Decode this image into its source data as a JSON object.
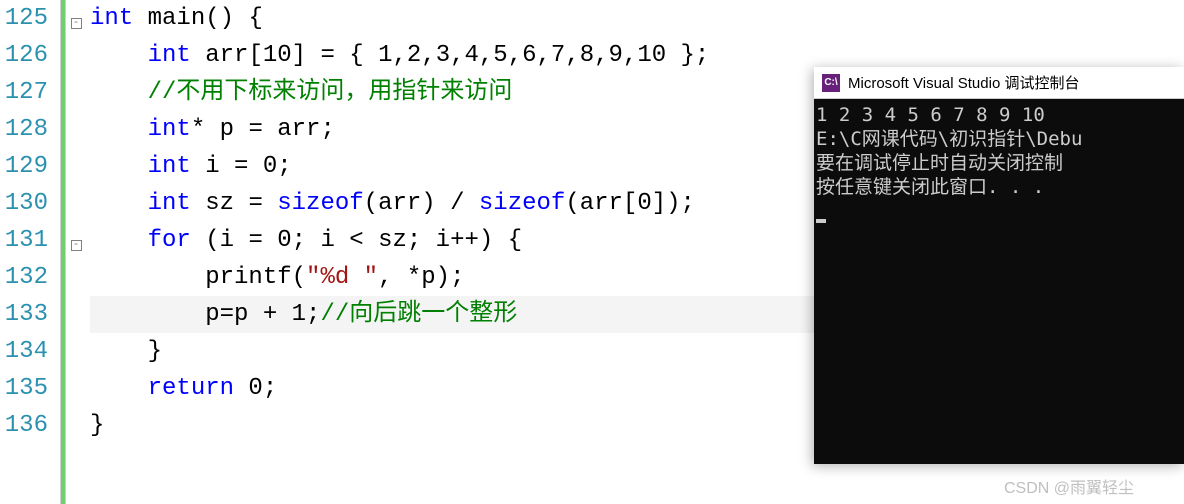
{
  "editor": {
    "lineNumbers": [
      "125",
      "126",
      "127",
      "128",
      "129",
      "130",
      "131",
      "132",
      "133",
      "134",
      "135",
      "136"
    ],
    "foldHints": {
      "125": "-",
      "131": "-"
    },
    "code": {
      "125": {
        "tokens": [
          [
            "kw",
            "int"
          ],
          [
            "id",
            " main"
          ],
          [
            "pn",
            "() {"
          ]
        ]
      },
      "126": {
        "tokens": [
          [
            "pad",
            "    "
          ],
          [
            "kw",
            "int"
          ],
          [
            "id",
            " arr"
          ],
          [
            "pn",
            "["
          ],
          [
            "num",
            "10"
          ],
          [
            "pn",
            "] = { "
          ],
          [
            "num",
            "1,2,3,4,5,6,7,8,9,10"
          ],
          [
            "pn",
            " };"
          ]
        ]
      },
      "127": {
        "tokens": [
          [
            "pad",
            "    "
          ],
          [
            "cm",
            "//不用下标来访问，用指针来访问"
          ]
        ]
      },
      "128": {
        "tokens": [
          [
            "pad",
            "    "
          ],
          [
            "kw",
            "int"
          ],
          [
            "op",
            "* "
          ],
          [
            "id",
            "p = arr"
          ],
          [
            "pn",
            ";"
          ]
        ]
      },
      "129": {
        "tokens": [
          [
            "pad",
            "    "
          ],
          [
            "kw",
            "int"
          ],
          [
            "id",
            " i = "
          ],
          [
            "num",
            "0"
          ],
          [
            "pn",
            ";"
          ]
        ]
      },
      "130": {
        "tokens": [
          [
            "pad",
            "    "
          ],
          [
            "kw",
            "int"
          ],
          [
            "id",
            " sz = "
          ],
          [
            "szfn",
            "sizeof"
          ],
          [
            "pn",
            "(arr) / "
          ],
          [
            "szfn",
            "sizeof"
          ],
          [
            "pn",
            "(arr["
          ],
          [
            "num",
            "0"
          ],
          [
            "pn",
            "]);"
          ]
        ]
      },
      "131": {
        "tokens": [
          [
            "pad",
            "    "
          ],
          [
            "kw",
            "for"
          ],
          [
            "pn",
            " (i = "
          ],
          [
            "num",
            "0"
          ],
          [
            "pn",
            "; i < sz; i++) {"
          ]
        ]
      },
      "132": {
        "tokens": [
          [
            "pad",
            "        "
          ],
          [
            "id",
            "printf"
          ],
          [
            "pn",
            "("
          ],
          [
            "str",
            "\"%d \""
          ],
          [
            "pn",
            ", *p);"
          ]
        ]
      },
      "133": {
        "tokens": [
          [
            "pad",
            "        "
          ],
          [
            "id",
            "p=p + "
          ],
          [
            "num",
            "1"
          ],
          [
            "pn",
            ";"
          ],
          [
            "cm",
            "//向后跳一个整形"
          ]
        ],
        "current": true
      },
      "134": {
        "tokens": [
          [
            "pad",
            "    "
          ],
          [
            "pn",
            "}"
          ]
        ]
      },
      "135": {
        "tokens": [
          [
            "pad",
            "    "
          ],
          [
            "kw",
            "return"
          ],
          [
            "num",
            " 0"
          ],
          [
            "pn",
            ";"
          ]
        ]
      },
      "136": {
        "tokens": [
          [
            "pn",
            "}"
          ]
        ]
      }
    }
  },
  "console": {
    "iconText": "C:\\",
    "title": "Microsoft Visual Studio 调试控制台",
    "lines": [
      "1 2 3 4 5 6 7 8 9 10",
      "E:\\C网课代码\\初识指针\\Debu",
      "要在调试停止时自动关闭控制",
      "按任意键关闭此窗口. . ."
    ]
  },
  "watermark": "CSDN @雨翼轻尘"
}
